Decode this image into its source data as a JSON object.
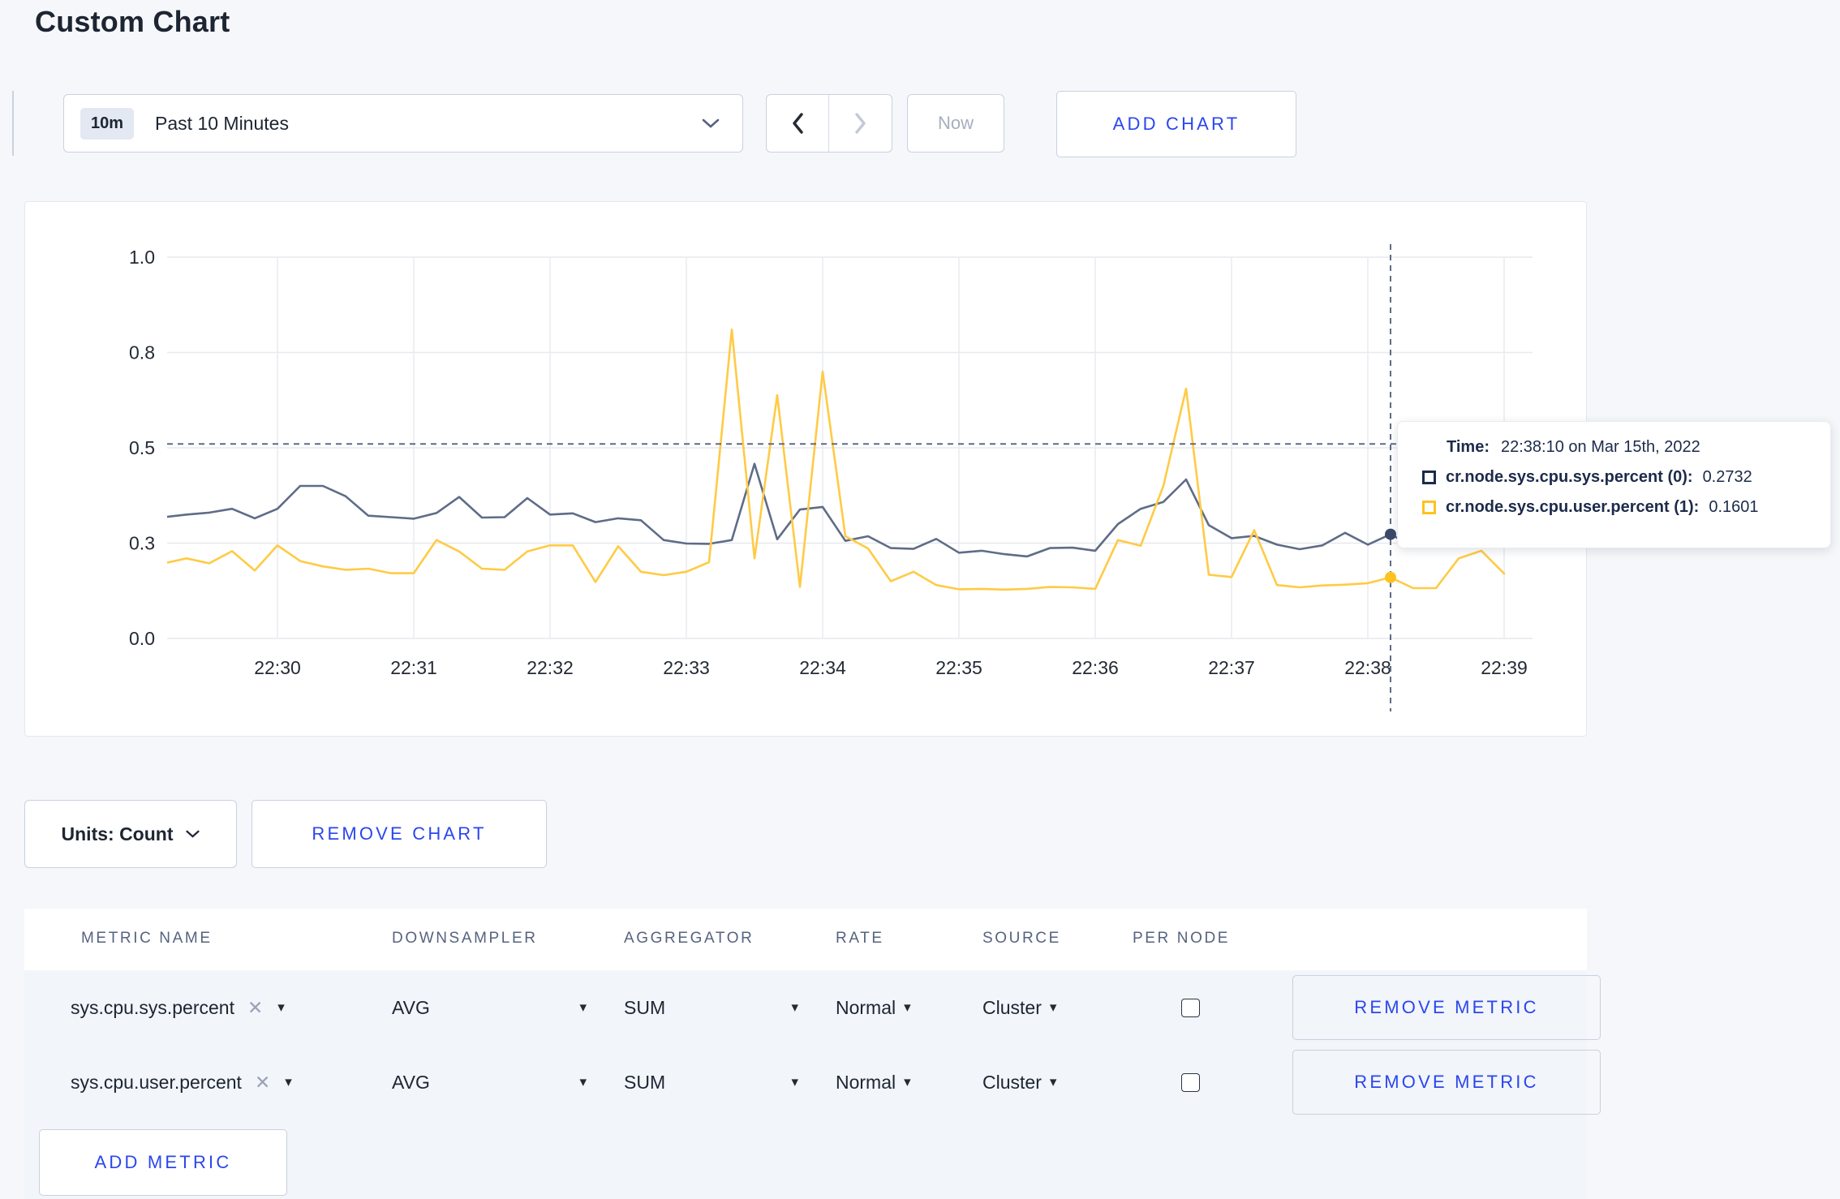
{
  "page": {
    "title": "Custom Chart",
    "accent_blue": "#2A46EE",
    "background": "#F5F7FA"
  },
  "icons": {
    "caret_down": "▾",
    "close": "✕"
  },
  "toolbar": {
    "time_range": {
      "badge": "10m",
      "label": "Past 10 Minutes"
    },
    "now_label": "Now",
    "add_chart_label": "ADD CHART"
  },
  "chart_controls": {
    "units_label": "Units: Count",
    "remove_chart_label": "REMOVE CHART"
  },
  "tooltip": {
    "time_label": "Time:",
    "time_value": "22:38:10 on Mar 15th, 2022",
    "rows": [
      {
        "name": "cr.node.sys.cpu.sys.percent (0):",
        "value": "0.2732",
        "swatch_color": "#1C2B4A"
      },
      {
        "name": "cr.node.sys.cpu.user.percent (1):",
        "value": "0.1601",
        "swatch_color": "#FFC21E"
      }
    ]
  },
  "chart_data": {
    "type": "line",
    "title": "",
    "xlabel": "",
    "ylabel": "",
    "ylim": [
      0,
      1
    ],
    "grid": true,
    "legend_position": "tooltip-only",
    "y_ticks": [
      {
        "v": 0.0,
        "label": "0.0"
      },
      {
        "v": 0.25,
        "label": "0.3"
      },
      {
        "v": 0.5,
        "label": "0.5"
      },
      {
        "v": 0.75,
        "label": "0.8"
      },
      {
        "v": 1.0,
        "label": "1.0"
      }
    ],
    "x_ticks": [
      {
        "t": 0,
        "label": "22:30"
      },
      {
        "t": 60,
        "label": "22:31"
      },
      {
        "t": 120,
        "label": "22:32"
      },
      {
        "t": 180,
        "label": "22:33"
      },
      {
        "t": 240,
        "label": "22:34"
      },
      {
        "t": 300,
        "label": "22:35"
      },
      {
        "t": 360,
        "label": "22:36"
      },
      {
        "t": 420,
        "label": "22:37"
      },
      {
        "t": 480,
        "label": "22:38"
      },
      {
        "t": 540,
        "label": "22:39"
      }
    ],
    "hover": {
      "t": 490,
      "time_label": "22:38:10 on Mar 15th, 2022",
      "guide_value": 0.51,
      "values": [
        0.2732,
        0.1601
      ],
      "dot_colors": [
        "#3A4A68",
        "#FFC21E"
      ]
    },
    "series": [
      {
        "name": "cr.node.sys.cpu.sys.percent",
        "color": "#5F6C87",
        "points": [
          [
            -50,
            0.318
          ],
          [
            -40,
            0.325
          ],
          [
            -30,
            0.33
          ],
          [
            -20,
            0.34
          ],
          [
            -10,
            0.315
          ],
          [
            0,
            0.34
          ],
          [
            10,
            0.4
          ],
          [
            20,
            0.4
          ],
          [
            30,
            0.373
          ],
          [
            40,
            0.322
          ],
          [
            50,
            0.318
          ],
          [
            60,
            0.314
          ],
          [
            70,
            0.329
          ],
          [
            80,
            0.371
          ],
          [
            90,
            0.317
          ],
          [
            100,
            0.318
          ],
          [
            110,
            0.368
          ],
          [
            120,
            0.325
          ],
          [
            130,
            0.328
          ],
          [
            140,
            0.305
          ],
          [
            150,
            0.315
          ],
          [
            160,
            0.31
          ],
          [
            170,
            0.258
          ],
          [
            180,
            0.249
          ],
          [
            190,
            0.248
          ],
          [
            200,
            0.258
          ],
          [
            210,
            0.458
          ],
          [
            220,
            0.26
          ],
          [
            230,
            0.338
          ],
          [
            240,
            0.345
          ],
          [
            250,
            0.256
          ],
          [
            260,
            0.268
          ],
          [
            270,
            0.237
          ],
          [
            280,
            0.235
          ],
          [
            290,
            0.261
          ],
          [
            300,
            0.225
          ],
          [
            310,
            0.23
          ],
          [
            320,
            0.221
          ],
          [
            330,
            0.215
          ],
          [
            340,
            0.237
          ],
          [
            350,
            0.238
          ],
          [
            360,
            0.23
          ],
          [
            370,
            0.3
          ],
          [
            380,
            0.34
          ],
          [
            390,
            0.358
          ],
          [
            400,
            0.417
          ],
          [
            410,
            0.297
          ],
          [
            420,
            0.263
          ],
          [
            430,
            0.269
          ],
          [
            440,
            0.246
          ],
          [
            450,
            0.234
          ],
          [
            460,
            0.244
          ],
          [
            470,
            0.277
          ],
          [
            480,
            0.246
          ],
          [
            490,
            0.2732
          ],
          [
            500,
            0.241
          ],
          [
            510,
            0.252
          ],
          [
            520,
            0.26
          ],
          [
            530,
            0.268
          ],
          [
            540,
            0.26
          ]
        ]
      },
      {
        "name": "cr.node.sys.cpu.user.percent",
        "color": "#FFCB45",
        "points": [
          [
            -50,
            0.197
          ],
          [
            -40,
            0.21
          ],
          [
            -30,
            0.197
          ],
          [
            -20,
            0.229
          ],
          [
            -10,
            0.178
          ],
          [
            0,
            0.244
          ],
          [
            10,
            0.203
          ],
          [
            20,
            0.189
          ],
          [
            30,
            0.18
          ],
          [
            40,
            0.183
          ],
          [
            50,
            0.171
          ],
          [
            60,
            0.171
          ],
          [
            70,
            0.258
          ],
          [
            80,
            0.228
          ],
          [
            90,
            0.183
          ],
          [
            100,
            0.18
          ],
          [
            110,
            0.228
          ],
          [
            120,
            0.244
          ],
          [
            130,
            0.244
          ],
          [
            140,
            0.148
          ],
          [
            150,
            0.242
          ],
          [
            160,
            0.175
          ],
          [
            170,
            0.166
          ],
          [
            180,
            0.175
          ],
          [
            190,
            0.2
          ],
          [
            200,
            0.81
          ],
          [
            210,
            0.21
          ],
          [
            220,
            0.638
          ],
          [
            230,
            0.135
          ],
          [
            240,
            0.7
          ],
          [
            250,
            0.268
          ],
          [
            260,
            0.236
          ],
          [
            270,
            0.15
          ],
          [
            280,
            0.175
          ],
          [
            290,
            0.14
          ],
          [
            300,
            0.129
          ],
          [
            310,
            0.13
          ],
          [
            320,
            0.128
          ],
          [
            330,
            0.13
          ],
          [
            340,
            0.135
          ],
          [
            350,
            0.134
          ],
          [
            360,
            0.13
          ],
          [
            370,
            0.258
          ],
          [
            380,
            0.243
          ],
          [
            390,
            0.4
          ],
          [
            400,
            0.655
          ],
          [
            410,
            0.167
          ],
          [
            420,
            0.161
          ],
          [
            430,
            0.284
          ],
          [
            440,
            0.14
          ],
          [
            450,
            0.134
          ],
          [
            460,
            0.139
          ],
          [
            470,
            0.141
          ],
          [
            480,
            0.145
          ],
          [
            490,
            0.1601
          ],
          [
            500,
            0.132
          ],
          [
            510,
            0.132
          ],
          [
            520,
            0.21
          ],
          [
            530,
            0.23
          ],
          [
            540,
            0.17
          ]
        ]
      }
    ]
  },
  "metrics_table": {
    "headers": [
      "METRIC NAME",
      "DOWNSAMPLER",
      "AGGREGATOR",
      "RATE",
      "SOURCE",
      "PER NODE"
    ],
    "rows": [
      {
        "metric": "sys.cpu.sys.percent",
        "downsampler": "AVG",
        "aggregator": "SUM",
        "rate": "Normal",
        "source": "Cluster",
        "per_node_checked": false,
        "remove_label": "REMOVE METRIC"
      },
      {
        "metric": "sys.cpu.user.percent",
        "downsampler": "AVG",
        "aggregator": "SUM",
        "rate": "Normal",
        "source": "Cluster",
        "per_node_checked": false,
        "remove_label": "REMOVE METRIC"
      }
    ],
    "add_metric_label": "ADD METRIC"
  }
}
